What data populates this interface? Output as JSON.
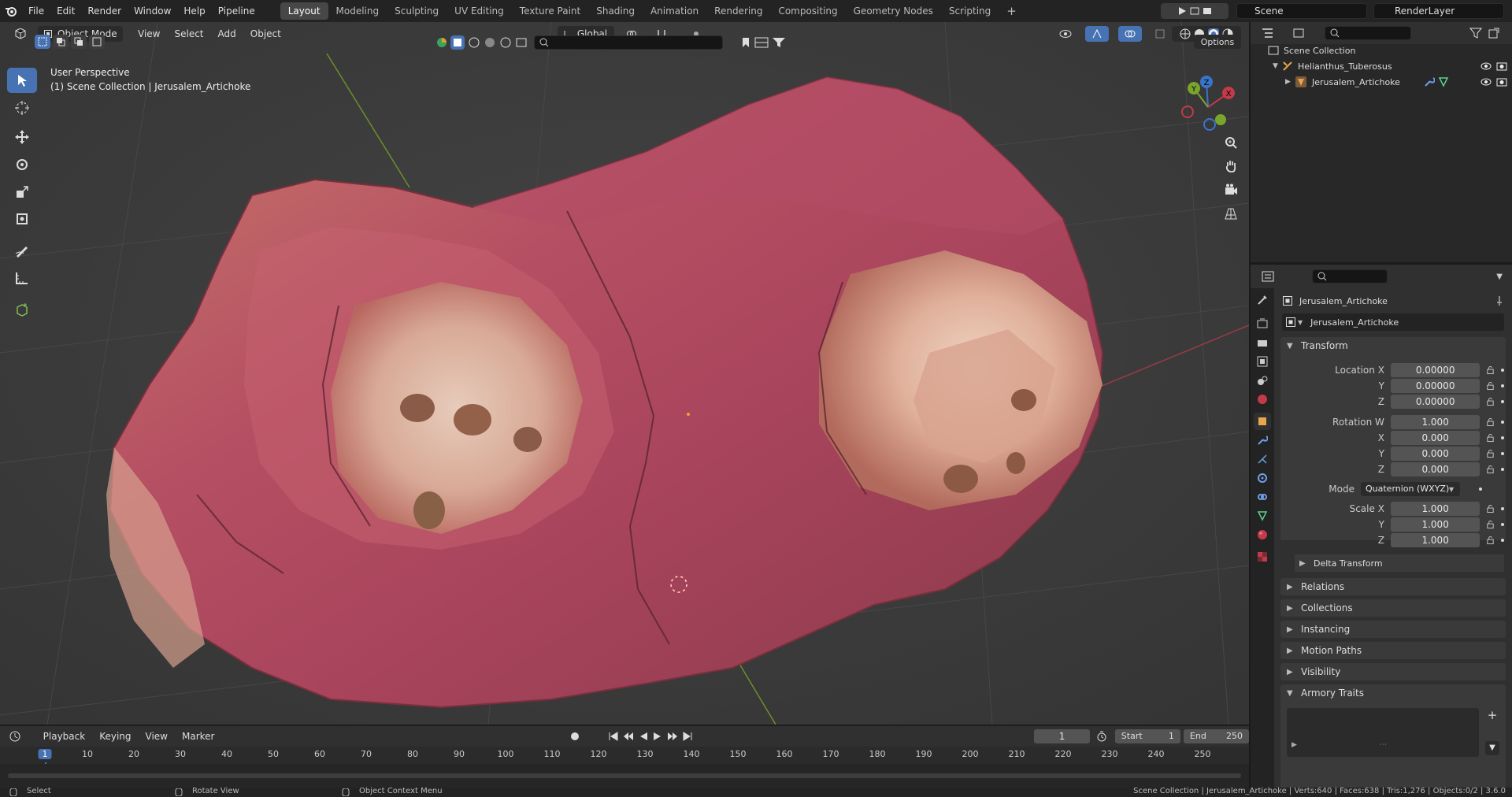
{
  "topbar": {
    "menus": [
      "File",
      "Edit",
      "Render",
      "Window",
      "Help",
      "Pipeline"
    ],
    "workspaces": [
      "Layout",
      "Modeling",
      "Sculpting",
      "UV Editing",
      "Texture Paint",
      "Shading",
      "Animation",
      "Rendering",
      "Compositing",
      "Geometry Nodes",
      "Scripting"
    ],
    "active_workspace": "Layout",
    "scene_label": "Scene",
    "renderlayer_label": "RenderLayer"
  },
  "viewport": {
    "mode_label": "Object Mode",
    "menus": [
      "View",
      "Select",
      "Add",
      "Object"
    ],
    "orientation_label": "Global",
    "options_label": "Options",
    "overlay_title": "User Perspective",
    "overlay_subtitle": "(1) Scene Collection | Jerusalem_Artichoke",
    "gizmo_axes": {
      "x": "X",
      "y": "Y",
      "z": "Z"
    },
    "colors": {
      "grid_x": "#9a3b46",
      "grid_y": "#6b8f2a",
      "tool_active": "#4772b3",
      "mesh_base": "#b55a6e"
    }
  },
  "outliner": {
    "root": "Scene Collection",
    "items": [
      {
        "label": "Helianthus_Tuberosus"
      },
      {
        "label": "Jerusalem_Artichoke"
      }
    ]
  },
  "properties": {
    "object_name": "Jerusalem_Artichoke",
    "data_name": "Jerusalem_Artichoke",
    "transform_title": "Transform",
    "rows": [
      {
        "label": "Location X",
        "value": "0.00000"
      },
      {
        "label": "Y",
        "value": "0.00000"
      },
      {
        "label": "Z",
        "value": "0.00000"
      },
      {
        "label": "Rotation W",
        "value": "1.000"
      },
      {
        "label": "X",
        "value": "0.000"
      },
      {
        "label": "Y",
        "value": "0.000"
      },
      {
        "label": "Z",
        "value": "0.000"
      },
      {
        "label": "Mode",
        "value": "Quaternion (WXYZ)"
      },
      {
        "label": "Scale X",
        "value": "1.000"
      },
      {
        "label": "Y",
        "value": "1.000"
      },
      {
        "label": "Z",
        "value": "1.000"
      }
    ],
    "delta_transform": "Delta Transform",
    "panels": [
      "Relations",
      "Collections",
      "Instancing",
      "Motion Paths",
      "Visibility",
      "Armory Traits"
    ]
  },
  "timeline": {
    "menus": [
      "Playback",
      "Keying",
      "View",
      "Marker"
    ],
    "current_frame": "1",
    "start_label": "Start",
    "start_value": "1",
    "end_label": "End",
    "end_value": "250",
    "ticks": [
      "1",
      "10",
      "20",
      "30",
      "40",
      "50",
      "60",
      "70",
      "80",
      "90",
      "100",
      "110",
      "120",
      "130",
      "140",
      "150",
      "160",
      "170",
      "180",
      "190",
      "200",
      "210",
      "220",
      "230",
      "240",
      "250"
    ]
  },
  "statusbar": {
    "select": "Select",
    "rotate": "Rotate View",
    "context": "Object Context Menu",
    "stats": "Scene Collection | Jerusalem_Artichoke | Verts:640 | Faces:638 | Tris:1,276 | Objects:0/2 | 3.6.0"
  }
}
